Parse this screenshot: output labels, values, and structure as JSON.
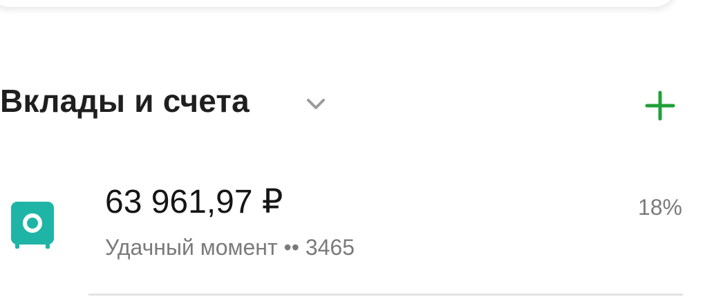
{
  "section": {
    "title": "Вклады и счета",
    "chevron_icon": "chevron-down-icon",
    "add_icon": "plus-icon",
    "accent_color": "#21A038"
  },
  "accounts": [
    {
      "icon": "safe-icon",
      "icon_color": "#1FB5A6",
      "amount": "63 961,97 ₽",
      "name": "Удачный момент •• 3465",
      "rate": "18%"
    }
  ]
}
